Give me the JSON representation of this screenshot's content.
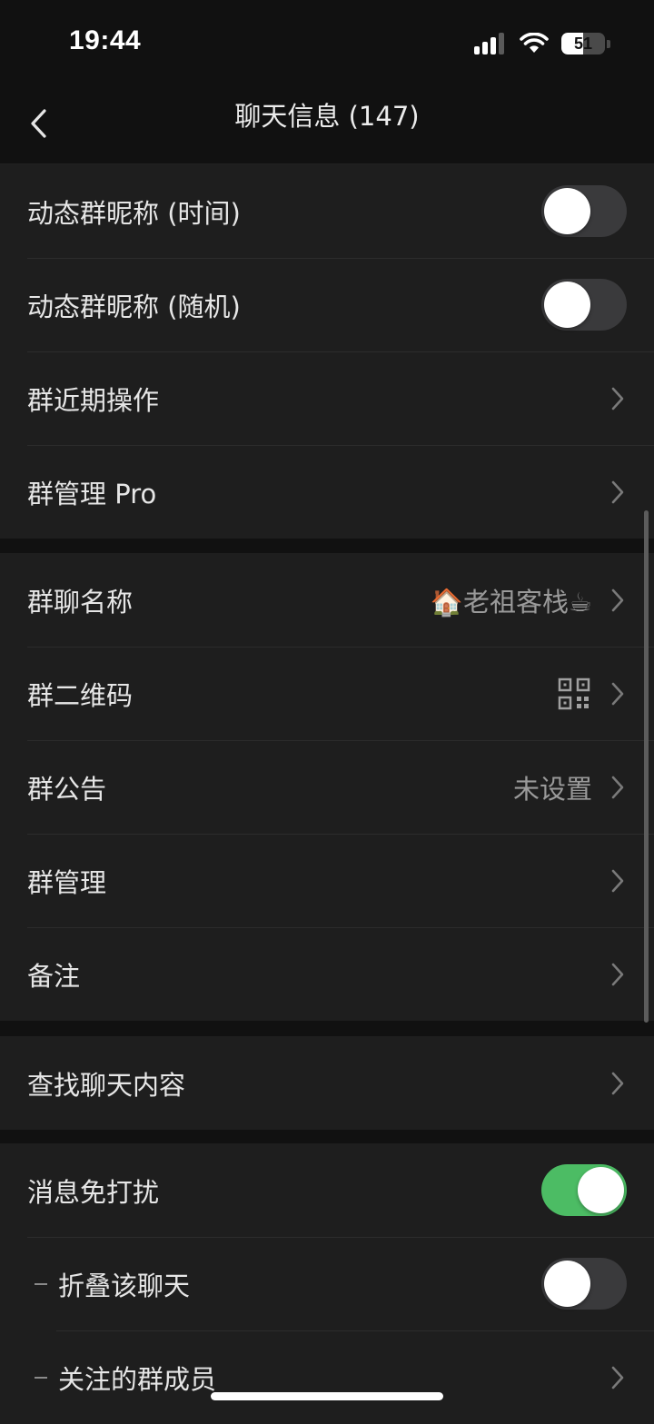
{
  "status_bar": {
    "time": "19:44",
    "battery_level": "51",
    "battery_fraction": 0.51,
    "icons": [
      "cellular-signal-icon",
      "wifi-icon",
      "battery-icon"
    ]
  },
  "nav": {
    "title": "聊天信息 (147)",
    "back_icon": "chevron-left-icon"
  },
  "group1": {
    "items": [
      {
        "label": "动态群昵称 (时间)",
        "toggle": false
      },
      {
        "label": "动态群昵称 (随机)",
        "toggle": false
      },
      {
        "label": "群近期操作"
      },
      {
        "label": "群管理 Pro"
      }
    ]
  },
  "group2": {
    "items": [
      {
        "label": "群聊名称",
        "value": "🏠老祖客栈☕"
      },
      {
        "label": "群二维码",
        "value_icon": "qr-code-icon"
      },
      {
        "label": "群公告",
        "value": "未设置"
      },
      {
        "label": "群管理"
      },
      {
        "label": "备注"
      }
    ]
  },
  "group3": {
    "items": [
      {
        "label": "查找聊天内容"
      }
    ]
  },
  "group4": {
    "items": [
      {
        "label": "消息免打扰",
        "toggle": true
      },
      {
        "label": "折叠该聊天",
        "toggle": false
      },
      {
        "label": "关注的群成员"
      }
    ]
  },
  "colors": {
    "background": "#111111",
    "cell": "#1e1e1e",
    "toggle_on": "#4cbc64",
    "toggle_off": "#3a3a3c"
  }
}
